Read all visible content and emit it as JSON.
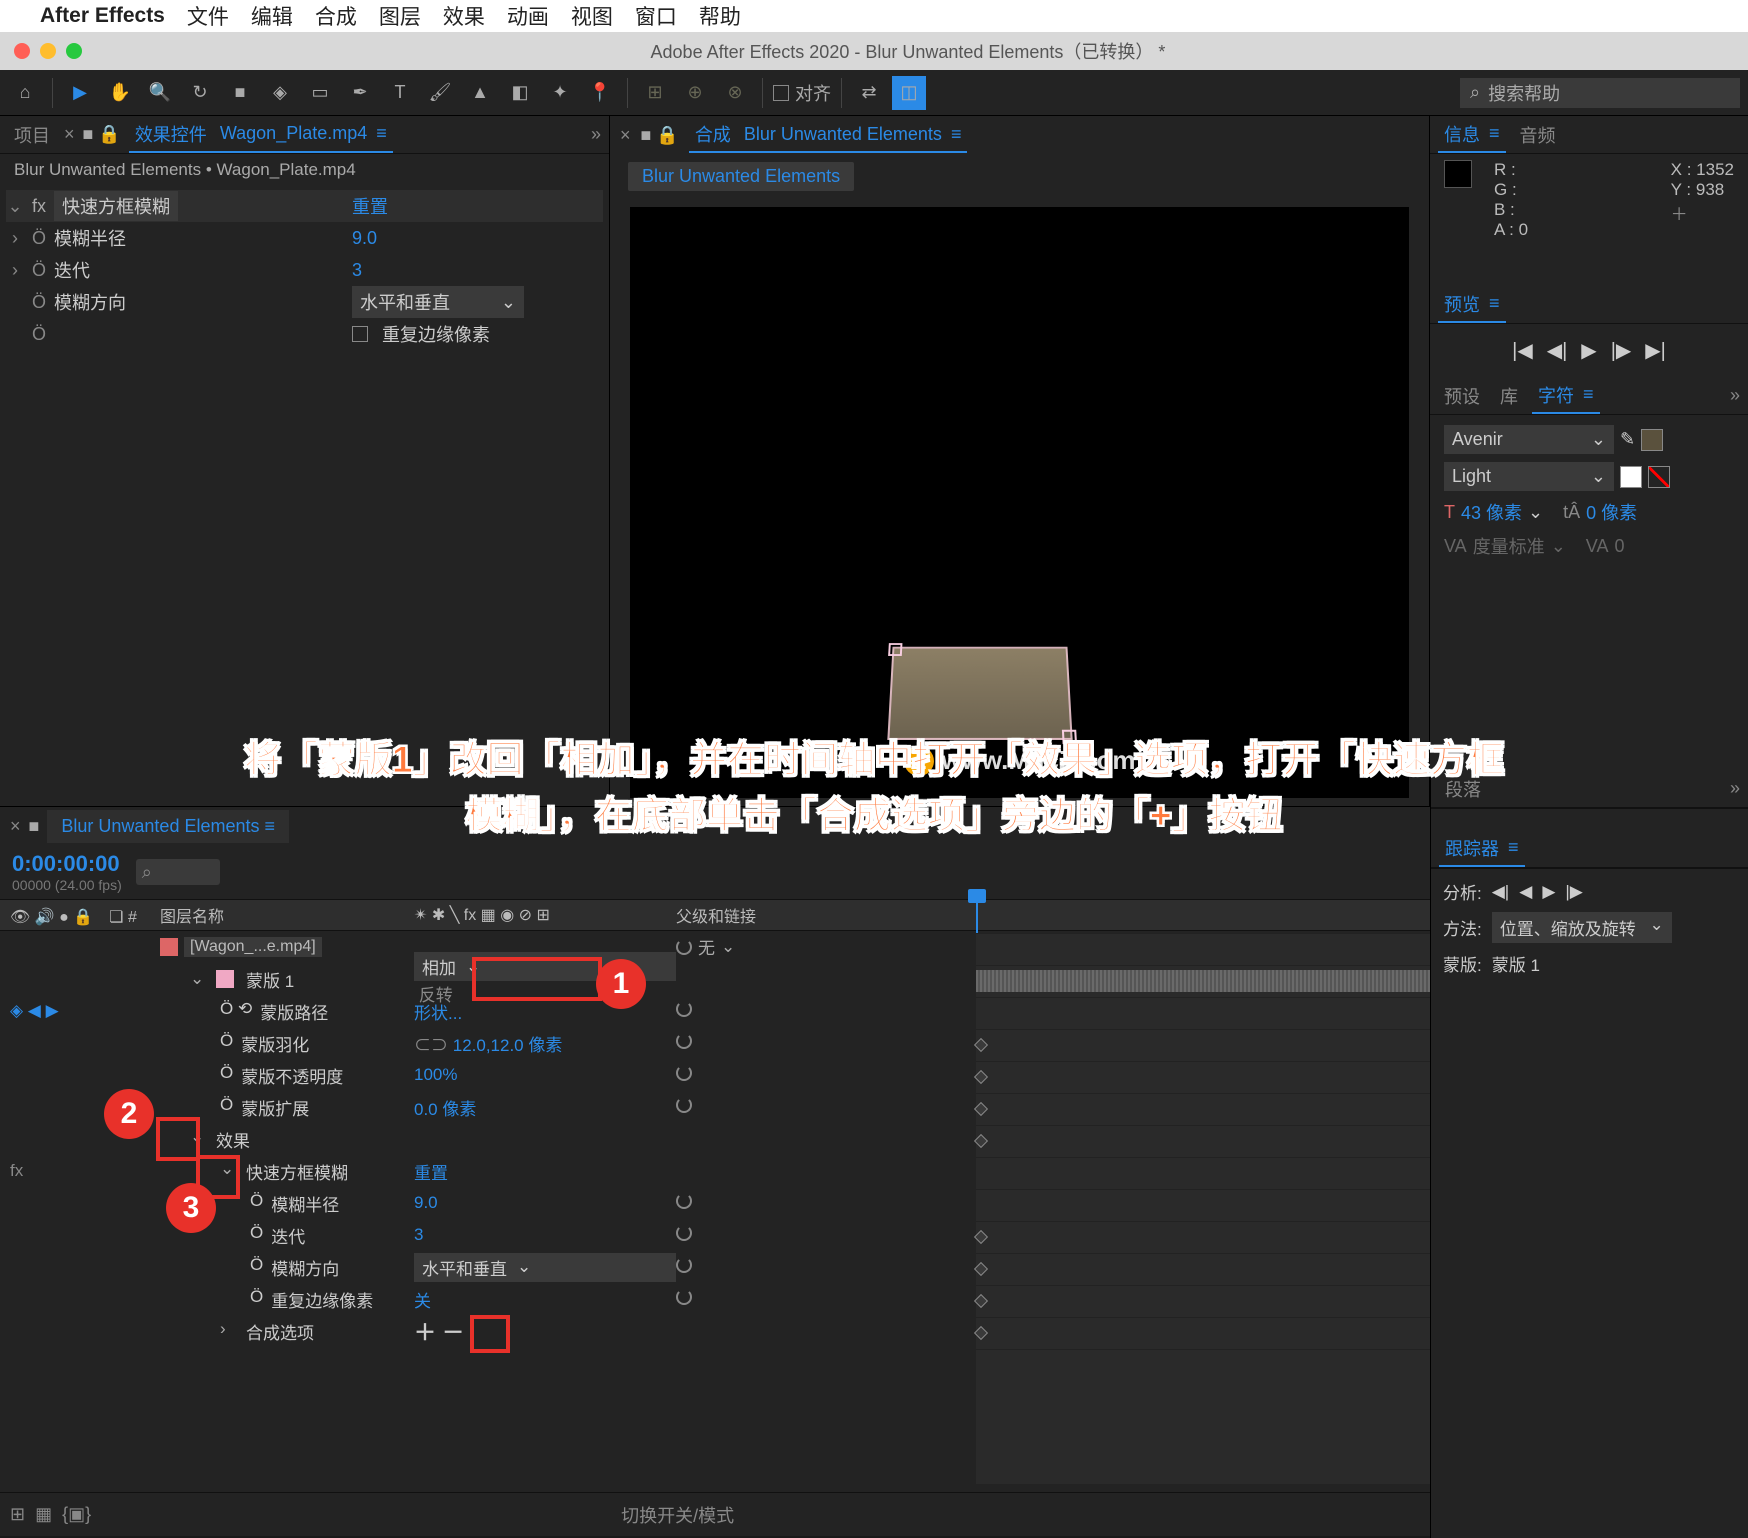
{
  "menubar": {
    "app": "After Effects",
    "items": [
      "文件",
      "编辑",
      "合成",
      "图层",
      "效果",
      "动画",
      "视图",
      "窗口",
      "帮助"
    ]
  },
  "window": {
    "title": "Adobe After Effects 2020 - Blur Unwanted Elements（已转换） *"
  },
  "toolbar": {
    "snapping": "对齐",
    "search_placeholder": "搜索帮助"
  },
  "left_panel": {
    "tab_project": "项目",
    "tab_effect_controls": "效果控件",
    "layer_name": "Wagon_Plate.mp4",
    "breadcrumb": "Blur Unwanted Elements • Wagon_Plate.mp4",
    "effect": {
      "name": "快速方框模糊",
      "reset": "重置",
      "props": {
        "radius_label": "模糊半径",
        "radius_value": "9.0",
        "iterations_label": "迭代",
        "iterations_value": "3",
        "direction_label": "模糊方向",
        "direction_value": "水平和垂直",
        "repeat_label": "重复边缘像素"
      }
    }
  },
  "comp_panel": {
    "prefix": "合成",
    "name": "Blur Unwanted Elements",
    "subtab": "Blur Unwanted Elements",
    "watermark": "www.MacZ.com"
  },
  "info_panel": {
    "tab_info": "信息",
    "tab_audio": "音频",
    "r": "R :",
    "g": "G :",
    "b": "B :",
    "a": "A :  0",
    "x": "X : 1352",
    "y": "Y : 938"
  },
  "preview_panel": {
    "title": "预览"
  },
  "side_tabs": {
    "presets": "预设",
    "library": "库",
    "character": "字符"
  },
  "character": {
    "font": "Avenir",
    "style": "Light",
    "size": "43 像素",
    "leading": "0 像素",
    "tracking": "度量标准",
    "kerning": "0"
  },
  "instruction_line1": "将「蒙版1」改回「相加」，并在时间轴中打开「效果」选项，打开「快速方框",
  "instruction_line2": "模糊」，在底部单击「合成选项」旁边的「+」按钮",
  "timeline": {
    "comp_name": "Blur Unwanted Elements",
    "timecode": "0:00:00:00",
    "timecode_sub": "00000 (24.00 fps)",
    "header": {
      "layer_name": "图层名称",
      "parent": "父级和链接"
    },
    "layer_row": {
      "name": "[Wagon_...e.mp4]",
      "parent_none": "无"
    },
    "mask": {
      "name": "蒙版 1",
      "mode": "相加",
      "invert": "反转",
      "path_label": "蒙版路径",
      "path_value": "形状...",
      "feather_label": "蒙版羽化",
      "feather_value": "12.0,12.0 像素",
      "opacity_label": "蒙版不透明度",
      "opacity_value": "100%",
      "expansion_label": "蒙版扩展",
      "expansion_value": "0.0 像素"
    },
    "effects_group": "效果",
    "effect": {
      "name": "快速方框模糊",
      "reset": "重置",
      "radius_label": "模糊半径",
      "radius_value": "9.0",
      "iter_label": "迭代",
      "iter_value": "3",
      "dir_label": "模糊方向",
      "dir_value": "水平和垂直",
      "repeat_label": "重复边缘像素",
      "repeat_value": "关"
    },
    "comp_options": "合成选项",
    "footer_mode": "切换开关/模式"
  },
  "right_bottom": {
    "paragraph": "段落",
    "tracker": "跟踪器",
    "analyze": "分析:",
    "method_label": "方法:",
    "method_value": "位置、缩放及旋转",
    "mask_label": "蒙版:",
    "mask_value": "蒙版 1"
  },
  "annotations": {
    "n1": "1",
    "n2": "2",
    "n3": "3"
  }
}
